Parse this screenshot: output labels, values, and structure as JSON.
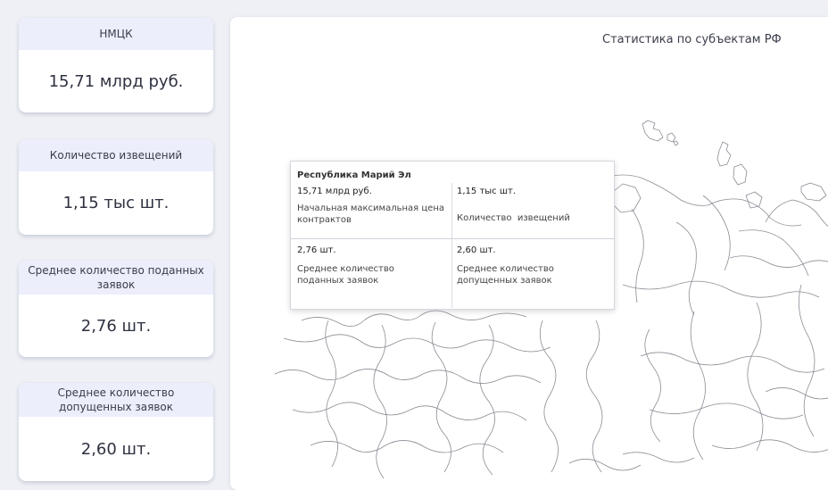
{
  "kpis": [
    {
      "title": "НМЦК",
      "value": "15,71 млрд руб."
    },
    {
      "title": "Количество извещений",
      "value": "1,15 тыс шт."
    },
    {
      "title": "Среднее количество поданных заявок",
      "value": "2,76 шт."
    },
    {
      "title": "Среднее количество допущенных заявок",
      "value": "2,60 шт."
    }
  ],
  "map": {
    "title": "Статистика по субъектам РФ"
  },
  "tooltip": {
    "region": "Республика Марий Эл",
    "cells": [
      {
        "value": "15,71 млрд руб.",
        "label": "Начальная максимальная цена контрактов"
      },
      {
        "value": "1,15 тыс шт.",
        "label": "Количество  извещений"
      },
      {
        "value": "2,76 шт.",
        "label": "Среднее количество поданных заявок"
      },
      {
        "value": "2,60 шт.",
        "label": "Среднее количество допущенных заявок"
      }
    ]
  }
}
